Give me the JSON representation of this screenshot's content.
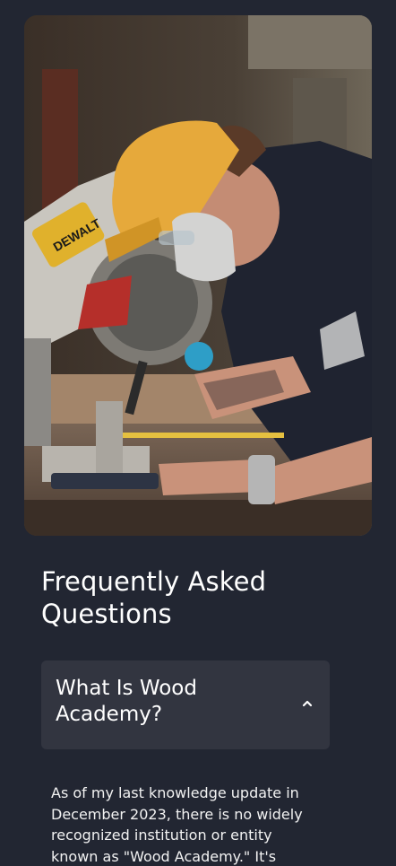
{
  "hero_image": {
    "alt": "Woodworker in yellow cap and face mask using a DeWALT miter saw",
    "saw_brand": "DEWALT"
  },
  "faq": {
    "title": "Frequently Asked Questions",
    "items": [
      {
        "question": "What Is Wood Academy?",
        "expanded": true,
        "answer": "As of my last knowledge update in December 2023, there is no widely recognized institution or entity known as \"Wood Academy.\" It's"
      }
    ]
  },
  "icons": {
    "toggle": "chevron-up-icon"
  },
  "colors": {
    "background": "#222632",
    "card": "#323540",
    "text": "#ffffff"
  }
}
